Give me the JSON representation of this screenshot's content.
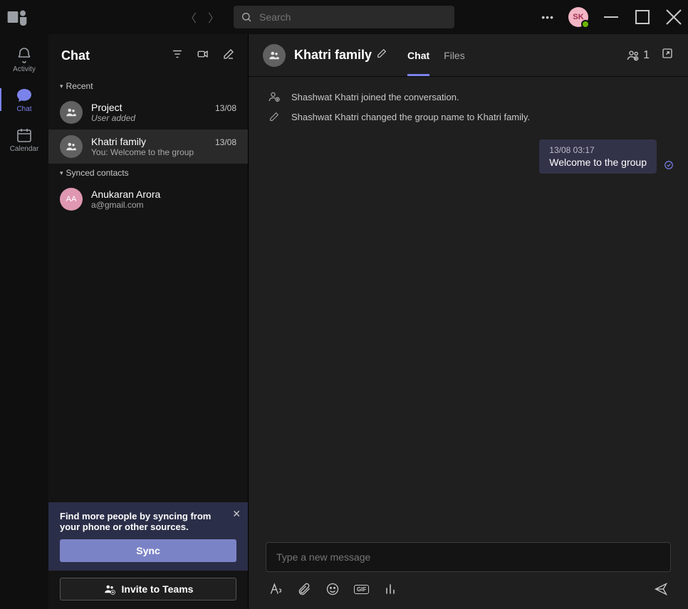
{
  "search": {
    "placeholder": "Search"
  },
  "user": {
    "initials": "SK"
  },
  "rail": {
    "activity": "Activity",
    "chat": "Chat",
    "calendar": "Calendar"
  },
  "chatlist": {
    "title": "Chat",
    "sections": {
      "recent": "Recent",
      "synced": "Synced contacts"
    },
    "items": [
      {
        "name": "Project",
        "date": "13/08",
        "preview": "User added"
      },
      {
        "name": "Khatri family",
        "date": "13/08",
        "preview": "You: Welcome to the group"
      }
    ],
    "contacts": [
      {
        "name": "Anukaran Arora",
        "initials": "AA",
        "email": "a@gmail.com"
      }
    ]
  },
  "promo": {
    "text": "Find more people by syncing from your phone or other sources.",
    "sync": "Sync",
    "invite": "Invite to Teams"
  },
  "conversation": {
    "title": "Khatri family",
    "tabs": {
      "chat": "Chat",
      "files": "Files"
    },
    "people_count": "1",
    "system": [
      "Shashwat Khatri joined the conversation.",
      "Shashwat Khatri changed the group name to Khatri family."
    ],
    "message": {
      "time": "13/08 03:17",
      "text": "Welcome to the group"
    },
    "compose_placeholder": "Type a new message"
  }
}
